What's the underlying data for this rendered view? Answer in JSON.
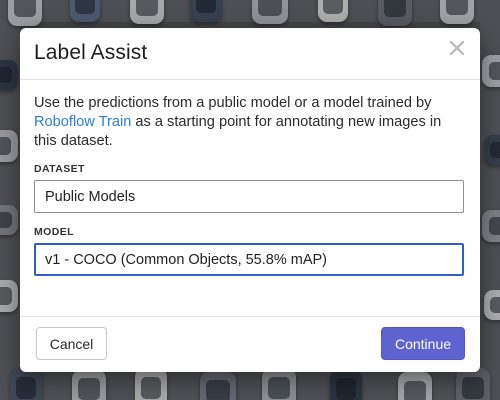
{
  "modal": {
    "title": "Label Assist",
    "description_prefix": "Use the predictions from a public model or a model trained by ",
    "link_text": "Roboflow Train",
    "description_suffix": " as a starting point for annotating new images in this dataset.",
    "dataset": {
      "label": "DATASET",
      "value": "Public Models"
    },
    "model": {
      "label": "MODEL",
      "value": "v1 - COCO (Common Objects, 55.8% mAP)"
    },
    "buttons": {
      "cancel": "Cancel",
      "continue": "Continue"
    }
  },
  "icons": {
    "close": "close-icon"
  },
  "colors": {
    "link": "#2b7fdc",
    "primary_button": "#5d63cf",
    "focus_border": "#2f5fc9"
  }
}
